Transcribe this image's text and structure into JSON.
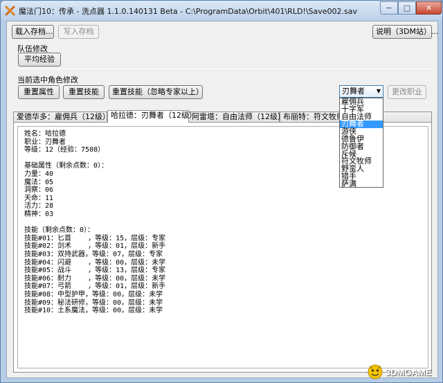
{
  "window": {
    "title": "魔法门10：传承 - 洗点器 1.1.0.140131 Beta - C:\\ProgramData\\Orbit\\401\\RLD!\\Save002.sav",
    "caption_min": "−",
    "caption_max": "□",
    "caption_close": "✕"
  },
  "toolbar": {
    "load_label": "载入存档...",
    "save_label": "写入存档",
    "help_label": "说明（3DM站）..."
  },
  "party": {
    "group_label": "队伍修改",
    "average_exp_label": "平均经验"
  },
  "character": {
    "group_label": "当前选中角色修改",
    "reset_attributes_label": "重置属性",
    "reset_skills_label": "重置技能",
    "reset_skills_ignore_label": "重置技能（忽略专家以上）",
    "class_selected": "刃舞者",
    "change_class_label": "更改职业",
    "class_options": [
      "雇佣兵",
      "十字军",
      "自由法师",
      "刃舞者",
      "游侠",
      "德鲁伊",
      "防御者",
      "斥候",
      "符文牧师",
      "野蛮人",
      "猎手",
      "萨满"
    ],
    "selected_index": 3
  },
  "tabs": [
    "爱德华多：雇佣兵（12级）",
    "哈拉德：刃舞者（12级）",
    "阿雷塔：自由法师（12级）",
    "布丽特：符文牧师（"
  ],
  "active_tab": 1,
  "info_lines": [
    "姓名：哈拉德",
    "职业：刃舞者",
    "等级：12（经验：7508）",
    "",
    "基础属性（剩余点数：0）：",
    "力量：40",
    "魔法：05",
    "洞察：06",
    "天命：11",
    "活力：28",
    "精神：03",
    "",
    "技能（剩余点数：0）：",
    "技能#01：匕首    ，等级：15，层级：专家",
    "技能#02：剑术    ，等级：01，层级：新手",
    "技能#03：双持武器，等级：07，层级：专家",
    "技能#04：闪避    ，等级：00，层级：未学",
    "技能#05：战斗    ，等级：13，层级：专家",
    "技能#06：耐力    ，等级：00，层级：未学",
    "技能#07：弓箭    ，等级：01，层级：新手",
    "技能#08：中型护甲，等级：00，层级：未学",
    "技能#09：秘法研修，等级：00，层级：未学",
    "技能#10：土系魔法，等级：00，层级：未学"
  ],
  "watermark": "3DMGAME"
}
